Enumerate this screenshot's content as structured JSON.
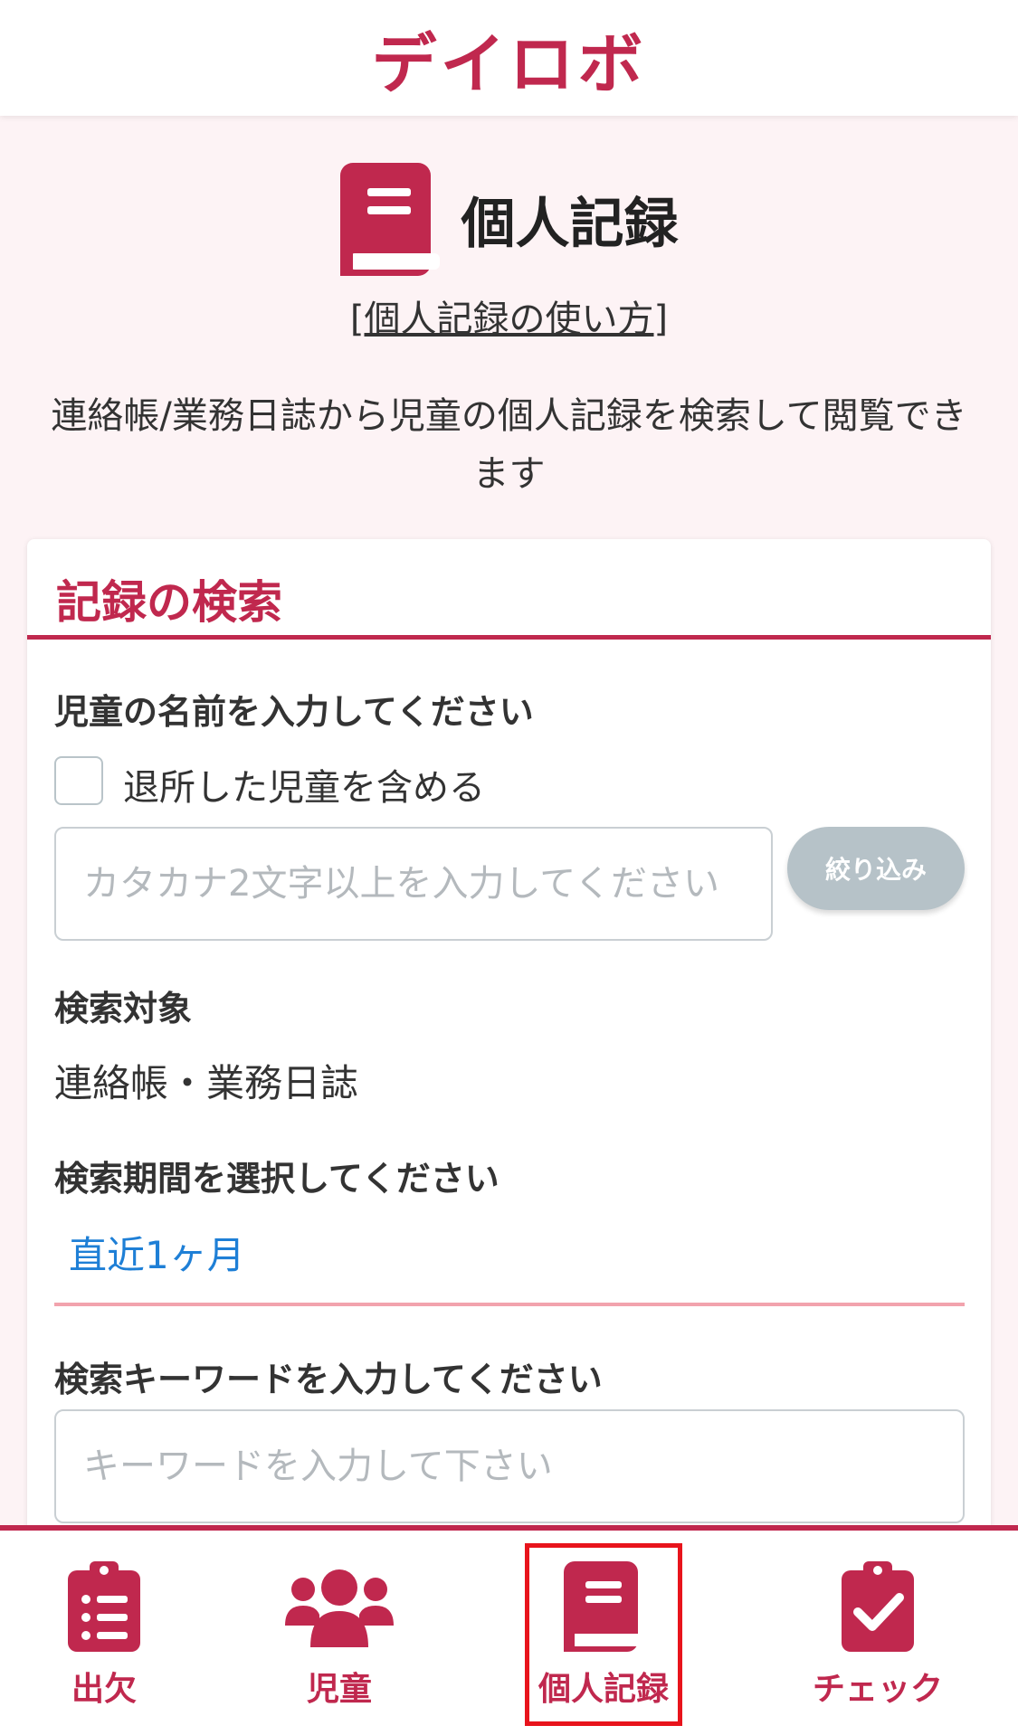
{
  "header": {
    "app_title": "デイロボ"
  },
  "page": {
    "title": "個人記録",
    "howto_open": "[",
    "howto_link": "個人記録の使い方",
    "howto_close": "]",
    "description": "連絡帳/業務日誌から児童の個人記録を検索して閲覧できます"
  },
  "search_card": {
    "title": "記録の検索",
    "child_name_label": "児童の名前を入力してください",
    "include_left_label": "退所した児童を含める",
    "include_left_checked": false,
    "name_input": {
      "value": "",
      "placeholder": "カタカナ2文字以上を入力してください"
    },
    "filter_button": "絞り込み",
    "target_label": "検索対象",
    "target_value": "連絡帳・業務日誌",
    "period_label": "検索期間を選択してください",
    "period_value": "直近1ヶ月",
    "keyword_label": "検索キーワードを入力してください",
    "keyword_input": {
      "value": "",
      "placeholder": "キーワードを入力して下さい"
    }
  },
  "bottom_nav": {
    "active": "個人記録",
    "items": [
      {
        "label": "出欠",
        "icon": "clipboard-list-icon"
      },
      {
        "label": "児童",
        "icon": "users-icon"
      },
      {
        "label": "個人記録",
        "icon": "book-icon"
      },
      {
        "label": "チェック",
        "icon": "clipboard-check-icon"
      }
    ]
  },
  "colors": {
    "brand": "#c0284e",
    "link_blue": "#1e7fd6",
    "active_highlight": "#e8141c",
    "button_disabled": "#b6c2c8"
  }
}
